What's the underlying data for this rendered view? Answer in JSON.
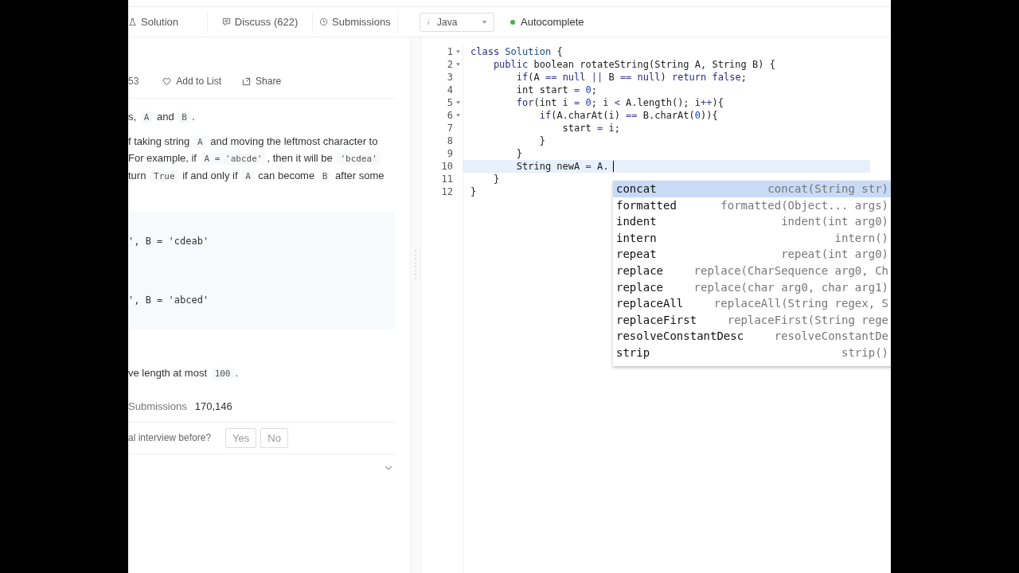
{
  "tabs": [
    {
      "label": "Solution",
      "selected": false
    },
    {
      "label": "Discuss (622)",
      "selected": false
    },
    {
      "label": "Submissions",
      "selected": false
    }
  ],
  "language": {
    "value": "Java"
  },
  "autocomplete": {
    "label": "Autocomplete",
    "on": true
  },
  "problem": {
    "count": "53",
    "actions": [
      {
        "label": "Add to List"
      },
      {
        "label": "Share"
      }
    ],
    "paragraphs": [
      [
        [
          {
            "kind": "text",
            "text": "s, "
          },
          {
            "kind": "code",
            "text": "A"
          },
          {
            "kind": "text",
            "text": " and "
          },
          {
            "kind": "code",
            "text": "B"
          },
          {
            "kind": "text",
            "text": "."
          }
        ]
      ],
      [
        [
          {
            "kind": "text",
            "text": "f taking string "
          },
          {
            "kind": "code",
            "text": "A"
          },
          {
            "kind": "text",
            "text": " and moving the leftmost character to"
          }
        ],
        [
          {
            "kind": "text",
            "text": "For example, if "
          },
          {
            "kind": "code",
            "text": "A = 'abcde'"
          },
          {
            "kind": "text",
            "text": ", then it will be "
          },
          {
            "kind": "code",
            "text": "'bcdea'"
          }
        ],
        [
          {
            "kind": "text",
            "text": "turn "
          },
          {
            "kind": "code",
            "text": "True"
          },
          {
            "kind": "text",
            "text": " if and only if "
          },
          {
            "kind": "code",
            "text": "A"
          },
          {
            "kind": "text",
            "text": " can become "
          },
          {
            "kind": "code",
            "text": "B"
          },
          {
            "kind": "text",
            "text": " after some"
          }
        ]
      ]
    ],
    "examples": [
      "', B = 'cdeab'",
      "', B = 'abced'"
    ],
    "note": [
      {
        "kind": "text",
        "text": "ve length at most "
      },
      {
        "kind": "code",
        "text": "100"
      },
      {
        "kind": "text",
        "text": "."
      }
    ],
    "submissions": {
      "label": "Submissions",
      "value": "170,146"
    },
    "question": {
      "text": "al interview before?",
      "buttons": [
        "Yes",
        "No"
      ]
    }
  },
  "editor": {
    "lines": [
      {
        "number": "1",
        "fold": true,
        "active": false,
        "tokens": [
          {
            "kind": "kw",
            "text": "class "
          },
          {
            "kind": "type",
            "text": "Solution"
          },
          {
            "kind": "txt",
            "text": " {"
          }
        ]
      },
      {
        "number": "2",
        "fold": true,
        "active": false,
        "tokens": [
          {
            "kind": "kw",
            "text": "    public"
          },
          {
            "kind": "txt",
            "text": " boolean rotateString(String A, String B) {"
          }
        ]
      },
      {
        "number": "3",
        "fold": false,
        "active": false,
        "tokens": [
          {
            "kind": "kw",
            "text": "        if"
          },
          {
            "kind": "txt",
            "text": "(A "
          },
          {
            "kind": "op",
            "text": "== "
          },
          {
            "kind": "kw",
            "text": "null "
          },
          {
            "kind": "op",
            "text": "||"
          },
          {
            "kind": "txt",
            "text": " B "
          },
          {
            "kind": "op",
            "text": "== "
          },
          {
            "kind": "kw",
            "text": "null"
          },
          {
            "kind": "txt",
            "text": ") "
          },
          {
            "kind": "kw",
            "text": "return false"
          },
          {
            "kind": "txt",
            "text": ";"
          }
        ]
      },
      {
        "number": "4",
        "fold": false,
        "active": false,
        "tokens": [
          {
            "kind": "txt",
            "text": "        int start "
          },
          {
            "kind": "op",
            "text": "= "
          },
          {
            "kind": "num",
            "text": "0"
          },
          {
            "kind": "txt",
            "text": ";"
          }
        ]
      },
      {
        "number": "5",
        "fold": true,
        "active": false,
        "tokens": [
          {
            "kind": "kw",
            "text": "        for"
          },
          {
            "kind": "txt",
            "text": "(int i "
          },
          {
            "kind": "op",
            "text": "= "
          },
          {
            "kind": "num",
            "text": "0"
          },
          {
            "kind": "txt",
            "text": "; i "
          },
          {
            "kind": "op",
            "text": "<"
          },
          {
            "kind": "txt",
            "text": " A.length(); i"
          },
          {
            "kind": "op",
            "text": "++"
          },
          {
            "kind": "txt",
            "text": "){"
          }
        ]
      },
      {
        "number": "6",
        "fold": true,
        "active": false,
        "tokens": [
          {
            "kind": "kw",
            "text": "            if"
          },
          {
            "kind": "txt",
            "text": "(A.charAt(i) "
          },
          {
            "kind": "op",
            "text": "=="
          },
          {
            "kind": "txt",
            "text": " B.charAt("
          },
          {
            "kind": "num",
            "text": "0"
          },
          {
            "kind": "txt",
            "text": ")){"
          }
        ]
      },
      {
        "number": "7",
        "fold": false,
        "active": false,
        "tokens": [
          {
            "kind": "txt",
            "text": "                start "
          },
          {
            "kind": "op",
            "text": "="
          },
          {
            "kind": "txt",
            "text": " i;"
          }
        ]
      },
      {
        "number": "8",
        "fold": false,
        "active": false,
        "tokens": [
          {
            "kind": "txt",
            "text": "            }"
          }
        ]
      },
      {
        "number": "9",
        "fold": false,
        "active": false,
        "tokens": [
          {
            "kind": "txt",
            "text": "        }"
          }
        ]
      },
      {
        "number": "10",
        "fold": false,
        "active": true,
        "tokens": [
          {
            "kind": "txt",
            "text": "        String newA "
          },
          {
            "kind": "op",
            "text": "="
          },
          {
            "kind": "txt",
            "text": " A."
          }
        ]
      },
      {
        "number": "11",
        "fold": false,
        "active": false,
        "tokens": [
          {
            "kind": "txt",
            "text": "    }"
          }
        ]
      },
      {
        "number": "12",
        "fold": false,
        "active": false,
        "tokens": [
          {
            "kind": "txt",
            "text": "}"
          }
        ]
      }
    ]
  },
  "suggestions": [
    {
      "name": "concat",
      "signature": "concat(String str)",
      "selected": true
    },
    {
      "name": "formatted",
      "signature": "formatted(Object... args)",
      "selected": false
    },
    {
      "name": "indent",
      "signature": "indent(int arg0)",
      "selected": false
    },
    {
      "name": "intern",
      "signature": "intern()",
      "selected": false
    },
    {
      "name": "repeat",
      "signature": "repeat(int arg0)",
      "selected": false
    },
    {
      "name": "replace",
      "signature": "replace(CharSequence arg0, Ch",
      "selected": false
    },
    {
      "name": "replace",
      "signature": "replace(char arg0, char arg1)",
      "selected": false
    },
    {
      "name": "replaceAll",
      "signature": "replaceAll(String regex, S",
      "selected": false
    },
    {
      "name": "replaceFirst",
      "signature": "replaceFirst(String rege",
      "selected": false
    },
    {
      "name": "resolveConstantDesc",
      "signature": "resolveConstantDe",
      "selected": false
    },
    {
      "name": "strip",
      "signature": "strip()",
      "selected": false
    }
  ]
}
